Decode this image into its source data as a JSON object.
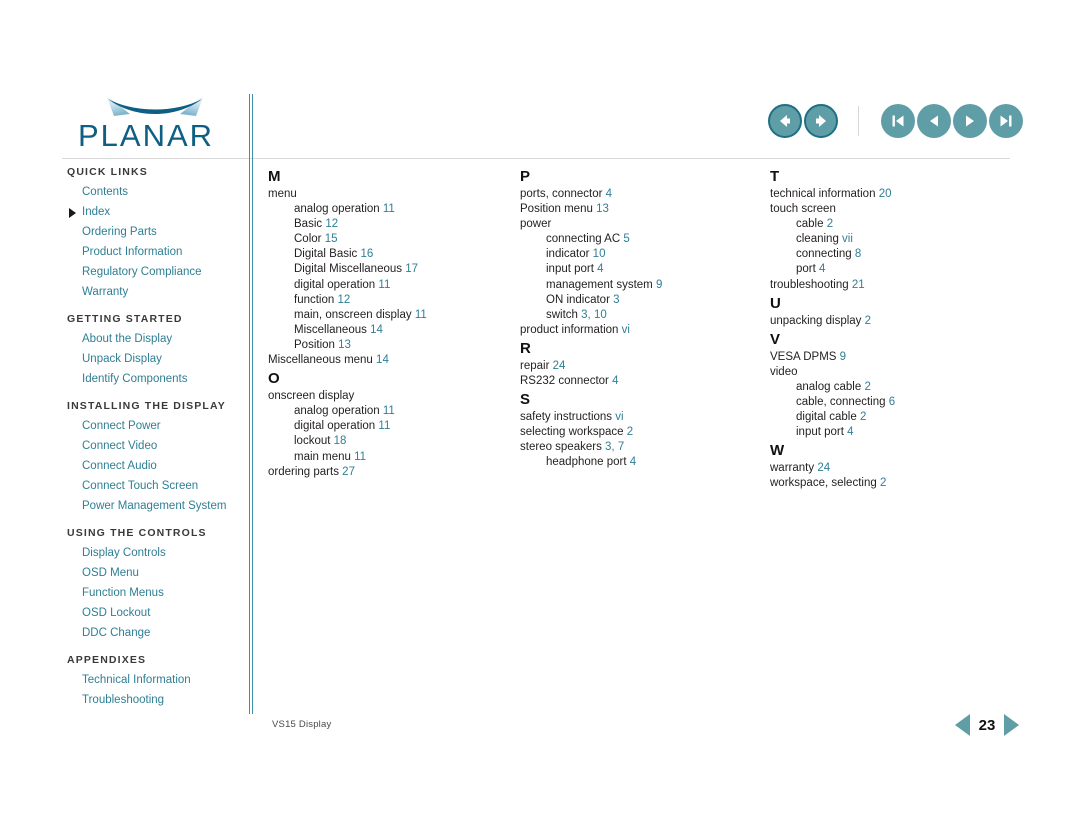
{
  "brand": {
    "name": "PLANAR",
    "logo_icon": "planar-swoosh-icon",
    "logo_color": "#0f5f84"
  },
  "colors": {
    "link": "#2f7f94",
    "page_number": "#2f7f94",
    "button_fill": "#5f9ea6",
    "button_ring": "#1d6f86",
    "heading": "#3a3a3a",
    "body_text": "#231f20",
    "rule": "#d9d9d9",
    "divider": "#3f8fa8"
  },
  "top_nav": {
    "group1": [
      {
        "name": "back-button",
        "icon": "arrow-left-icon",
        "label": "Back"
      },
      {
        "name": "forward-button",
        "icon": "arrow-right-icon",
        "label": "Forward"
      }
    ],
    "group2": [
      {
        "name": "first-page-button",
        "icon": "skip-to-start-icon",
        "label": "First Page"
      },
      {
        "name": "previous-page-button",
        "icon": "triangle-left-icon",
        "label": "Previous Page"
      },
      {
        "name": "next-page-button",
        "icon": "triangle-right-icon",
        "label": "Next Page"
      },
      {
        "name": "last-page-button",
        "icon": "skip-to-end-icon",
        "label": "Last Page"
      }
    ]
  },
  "sidebar": {
    "groups": [
      {
        "heading": "QUICK LINKS",
        "items": [
          {
            "label": "Contents",
            "current": false
          },
          {
            "label": "Index",
            "current": true
          },
          {
            "label": "Ordering Parts",
            "current": false
          },
          {
            "label": "Product Information",
            "current": false
          },
          {
            "label": "Regulatory Compliance",
            "current": false
          },
          {
            "label": "Warranty",
            "current": false
          }
        ]
      },
      {
        "heading": "GETTING STARTED",
        "items": [
          {
            "label": "About the Display",
            "current": false
          },
          {
            "label": "Unpack Display",
            "current": false
          },
          {
            "label": "Identify Components",
            "current": false
          }
        ]
      },
      {
        "heading": "INSTALLING THE DISPLAY",
        "items": [
          {
            "label": "Connect Power",
            "current": false
          },
          {
            "label": "Connect Video",
            "current": false
          },
          {
            "label": "Connect Audio",
            "current": false
          },
          {
            "label": "Connect Touch Screen",
            "current": false
          },
          {
            "label": "Power Management System",
            "current": false
          }
        ]
      },
      {
        "heading": "USING THE CONTROLS",
        "items": [
          {
            "label": "Display Controls",
            "current": false
          },
          {
            "label": "OSD Menu",
            "current": false
          },
          {
            "label": "Function Menus",
            "current": false
          },
          {
            "label": "OSD Lockout",
            "current": false
          },
          {
            "label": "DDC Change",
            "current": false
          }
        ]
      },
      {
        "heading": "APPENDIXES",
        "items": [
          {
            "label": "Technical Information",
            "current": false
          },
          {
            "label": "Troubleshooting",
            "current": false
          }
        ]
      }
    ]
  },
  "index": {
    "columns": [
      {
        "sections": [
          {
            "letter": "M",
            "entries": [
              {
                "text": "menu",
                "pages": "",
                "sub": false
              },
              {
                "text": "analog operation",
                "pages": "11",
                "sub": true
              },
              {
                "text": "Basic",
                "pages": "12",
                "sub": true
              },
              {
                "text": "Color",
                "pages": "15",
                "sub": true
              },
              {
                "text": "Digital Basic",
                "pages": "16",
                "sub": true
              },
              {
                "text": "Digital Miscellaneous",
                "pages": "17",
                "sub": true
              },
              {
                "text": "digital operation",
                "pages": "11",
                "sub": true
              },
              {
                "text": "function",
                "pages": "12",
                "sub": true
              },
              {
                "text": "main, onscreen display",
                "pages": "11",
                "sub": true
              },
              {
                "text": "Miscellaneous",
                "pages": "14",
                "sub": true
              },
              {
                "text": "Position",
                "pages": "13",
                "sub": true
              },
              {
                "text": "Miscellaneous menu",
                "pages": "14",
                "sub": false
              }
            ]
          },
          {
            "letter": "O",
            "entries": [
              {
                "text": "onscreen display",
                "pages": "",
                "sub": false
              },
              {
                "text": "analog operation",
                "pages": "11",
                "sub": true
              },
              {
                "text": "digital operation",
                "pages": "11",
                "sub": true
              },
              {
                "text": "lockout",
                "pages": "18",
                "sub": true
              },
              {
                "text": "main menu",
                "pages": "11",
                "sub": true
              },
              {
                "text": "ordering parts",
                "pages": "27",
                "sub": false
              }
            ]
          }
        ]
      },
      {
        "sections": [
          {
            "letter": "P",
            "entries": [
              {
                "text": "ports, connector",
                "pages": "4",
                "sub": false
              },
              {
                "text": "Position menu",
                "pages": "13",
                "sub": false
              },
              {
                "text": "power",
                "pages": "",
                "sub": false
              },
              {
                "text": "connecting AC",
                "pages": "5",
                "sub": true
              },
              {
                "text": "indicator",
                "pages": "10",
                "sub": true
              },
              {
                "text": "input port",
                "pages": "4",
                "sub": true
              },
              {
                "text": "management system",
                "pages": "9",
                "sub": true
              },
              {
                "text": "ON indicator",
                "pages": "3",
                "sub": true
              },
              {
                "text": "switch",
                "pages": "3, 10",
                "sub": true
              },
              {
                "text": "product information",
                "pages": "vi",
                "sub": false
              }
            ]
          },
          {
            "letter": "R",
            "entries": [
              {
                "text": "repair",
                "pages": "24",
                "sub": false
              },
              {
                "text": "RS232 connector",
                "pages": "4",
                "sub": false
              }
            ]
          },
          {
            "letter": "S",
            "entries": [
              {
                "text": "safety instructions",
                "pages": "vi",
                "sub": false
              },
              {
                "text": "selecting workspace",
                "pages": "2",
                "sub": false
              },
              {
                "text": "stereo speakers",
                "pages": "3, 7",
                "sub": false
              },
              {
                "text": "headphone port",
                "pages": "4",
                "sub": true
              }
            ]
          }
        ]
      },
      {
        "sections": [
          {
            "letter": "T",
            "entries": [
              {
                "text": "technical information",
                "pages": "20",
                "sub": false
              },
              {
                "text": "touch screen",
                "pages": "",
                "sub": false
              },
              {
                "text": "cable",
                "pages": "2",
                "sub": true
              },
              {
                "text": "cleaning",
                "pages": "vii",
                "sub": true
              },
              {
                "text": "connecting",
                "pages": "8",
                "sub": true
              },
              {
                "text": "port",
                "pages": "4",
                "sub": true
              },
              {
                "text": "troubleshooting",
                "pages": "21",
                "sub": false
              }
            ]
          },
          {
            "letter": "U",
            "entries": [
              {
                "text": "unpacking display",
                "pages": "2",
                "sub": false
              }
            ]
          },
          {
            "letter": "V",
            "entries": [
              {
                "text": "VESA DPMS",
                "pages": "9",
                "sub": false
              },
              {
                "text": "video",
                "pages": "",
                "sub": false
              },
              {
                "text": "analog cable",
                "pages": "2",
                "sub": true
              },
              {
                "text": "cable, connecting",
                "pages": "6",
                "sub": true
              },
              {
                "text": "digital cable",
                "pages": "2",
                "sub": true
              },
              {
                "text": "input port",
                "pages": "4",
                "sub": true
              }
            ]
          },
          {
            "letter": "W",
            "entries": [
              {
                "text": "warranty",
                "pages": "24",
                "sub": false
              },
              {
                "text": "workspace, selecting",
                "pages": "2",
                "sub": false
              }
            ]
          }
        ]
      }
    ]
  },
  "footer": {
    "document_label": "VS15 Display",
    "page_number": "23",
    "prev_icon": "triangle-left-icon",
    "next_icon": "triangle-right-icon"
  }
}
